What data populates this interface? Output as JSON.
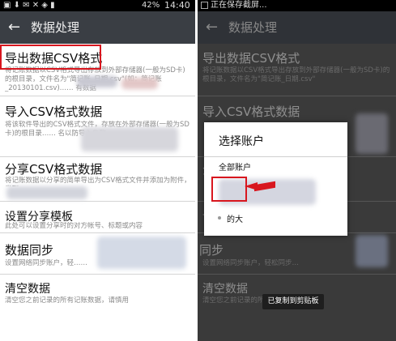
{
  "left": {
    "status": {
      "icons": "▣ ⬇        ✉ ✕ ◈ ▮",
      "battery": "42%",
      "time": "14:40"
    },
    "appbar": {
      "back": "←",
      "title": "数据处理"
    },
    "items": [
      {
        "title": "导出数据CSV格式",
        "desc": "将记账数据以CSV格式导出存放到外部存储器(一般为SD卡)的根目录，文件名为\"简记账_日期.csv\"(如：简记账_20130101.csv)…… 有数据"
      },
      {
        "title": "导入CSV格式数据",
        "desc": "将该软件导出的CSV格式文件，存放在外部存储器(一般为SD卡)的根目录…… 名以防导入失败，"
      },
      {
        "title": "分享CSV格式数据",
        "desc": "将记账数据以分享的简单导出为CSV格式文件并添加为附件，发到…"
      },
      {
        "title": "设置分享模板",
        "desc": "此处可以设置分享时的对方帐号、标题或内容"
      },
      {
        "title": "数据同步",
        "desc": "设置网络同步账户，轻……"
      },
      {
        "title": "清空数据",
        "desc": "清空您之前记录的所有记账数据，请慎用"
      }
    ]
  },
  "right": {
    "status": {
      "text": "正在保存截屏..."
    },
    "appbar": {
      "back": "←",
      "title": "数据处理"
    },
    "items": [
      {
        "title": "导出数据CSV格式",
        "desc": "将记账数据以CSV格式导出存放到外部存储器(一般为SD卡)的根目录，文件名为\"简记账_日期.csv\""
      },
      {
        "title": "导入CSV格式数据",
        "desc": ""
      },
      {
        "title": "分",
        "desc": ""
      },
      {
        "title": "设",
        "desc": ""
      },
      {
        "title": "同步",
        "desc": "设置网络同步账户，轻松同步…"
      },
      {
        "title": "清空数据",
        "desc": "清空您之前记录的所有记账数据，"
      }
    ],
    "dialog": {
      "title": "选择账户",
      "option_all": "全部账户",
      "option_other": "的大"
    },
    "toast": "已复制到剪贴板"
  },
  "colors": {
    "highlight": "#d8161e",
    "appbar": "#3a3e44",
    "divider": "#d4d4d4"
  }
}
